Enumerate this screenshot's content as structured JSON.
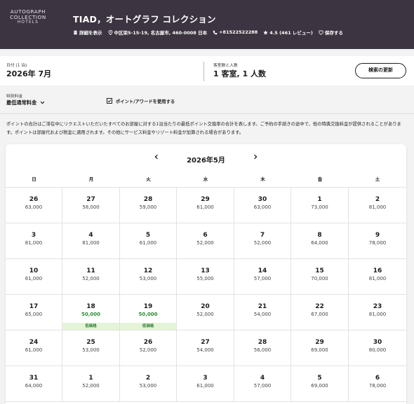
{
  "brand": {
    "line1": "AUTOGRAPH",
    "line2": "COLLECTION",
    "line3": "HOTELS"
  },
  "hotel": {
    "name": "TIAD，オートグラフ コレクション",
    "details_label": "詳細を表示",
    "address": "中区栄5-15-19, 名古屋市, 460-0008 日本",
    "phone": "+81522522288",
    "rating": "4.5 (461 レビュー)",
    "save_label": "保存する"
  },
  "search": {
    "date_label": "日付 (1 泊)",
    "date_value": "2026年 7月",
    "rooms_label": "客室数と人数",
    "rooms_value": "1 客室, 1 人数",
    "update_button": "検索の更新"
  },
  "filters": {
    "rate_label": "特別料金",
    "rate_value": "最低通常料金",
    "points_checkbox_label": "ポイント/アワードを使用する",
    "points_checked": true
  },
  "notice": "ポイントの合計はご滞在中にリクエストいただいたすべてのお部屋に対する1泊当たりの最低ポイント交換率の合計を表します。ご予約の手続きの途中で、他の特典交換料金が提供されることがあります。ポイントは部屋代および税金に適用されます。その他にサービス料金やリゾート料金が加算される場合があります。",
  "calendar": {
    "month_title": "2026年5月",
    "prev_icon": "chevron-left-icon",
    "next_icon": "chevron-right-icon",
    "weekdays": [
      "日",
      "月",
      "火",
      "水",
      "木",
      "金",
      "土"
    ],
    "low_badge": "低価格",
    "weeks": [
      [
        {
          "day": "26",
          "price": "63,000"
        },
        {
          "day": "27",
          "price": "58,000"
        },
        {
          "day": "28",
          "price": "59,000"
        },
        {
          "day": "29",
          "price": "61,000"
        },
        {
          "day": "30",
          "price": "63,000"
        },
        {
          "day": "1",
          "price": "73,000"
        },
        {
          "day": "2",
          "price": "81,000"
        }
      ],
      [
        {
          "day": "3",
          "price": "81,000"
        },
        {
          "day": "4",
          "price": "81,000"
        },
        {
          "day": "5",
          "price": "61,000"
        },
        {
          "day": "6",
          "price": "52,000"
        },
        {
          "day": "7",
          "price": "52,000"
        },
        {
          "day": "8",
          "price": "64,000"
        },
        {
          "day": "9",
          "price": "78,000"
        }
      ],
      [
        {
          "day": "10",
          "price": "61,000"
        },
        {
          "day": "11",
          "price": "52,000"
        },
        {
          "day": "12",
          "price": "53,000"
        },
        {
          "day": "13",
          "price": "55,000"
        },
        {
          "day": "14",
          "price": "57,000"
        },
        {
          "day": "15",
          "price": "70,000"
        },
        {
          "day": "16",
          "price": "81,000"
        }
      ],
      [
        {
          "day": "17",
          "price": "65,000"
        },
        {
          "day": "18",
          "price": "50,000",
          "low": true
        },
        {
          "day": "19",
          "price": "50,000",
          "low": true
        },
        {
          "day": "20",
          "price": "52,000"
        },
        {
          "day": "21",
          "price": "54,000"
        },
        {
          "day": "22",
          "price": "67,000"
        },
        {
          "day": "23",
          "price": "81,000"
        }
      ],
      [
        {
          "day": "24",
          "price": "61,000"
        },
        {
          "day": "25",
          "price": "53,000"
        },
        {
          "day": "26",
          "price": "52,000"
        },
        {
          "day": "27",
          "price": "54,000"
        },
        {
          "day": "28",
          "price": "56,000"
        },
        {
          "day": "29",
          "price": "69,000"
        },
        {
          "day": "30",
          "price": "80,000"
        }
      ],
      [
        {
          "day": "31",
          "price": "64,000"
        },
        {
          "day": "1",
          "price": "52,000"
        },
        {
          "day": "2",
          "price": "53,000"
        },
        {
          "day": "3",
          "price": "61,000"
        },
        {
          "day": "4",
          "price": "57,000"
        },
        {
          "day": "5",
          "price": "69,000"
        },
        {
          "day": "6",
          "price": "78,000"
        }
      ]
    ]
  },
  "colors": {
    "header_bg": "#3c3441",
    "low_price": "#2e8b3a",
    "low_badge_bg": "#e5f4d8"
  }
}
